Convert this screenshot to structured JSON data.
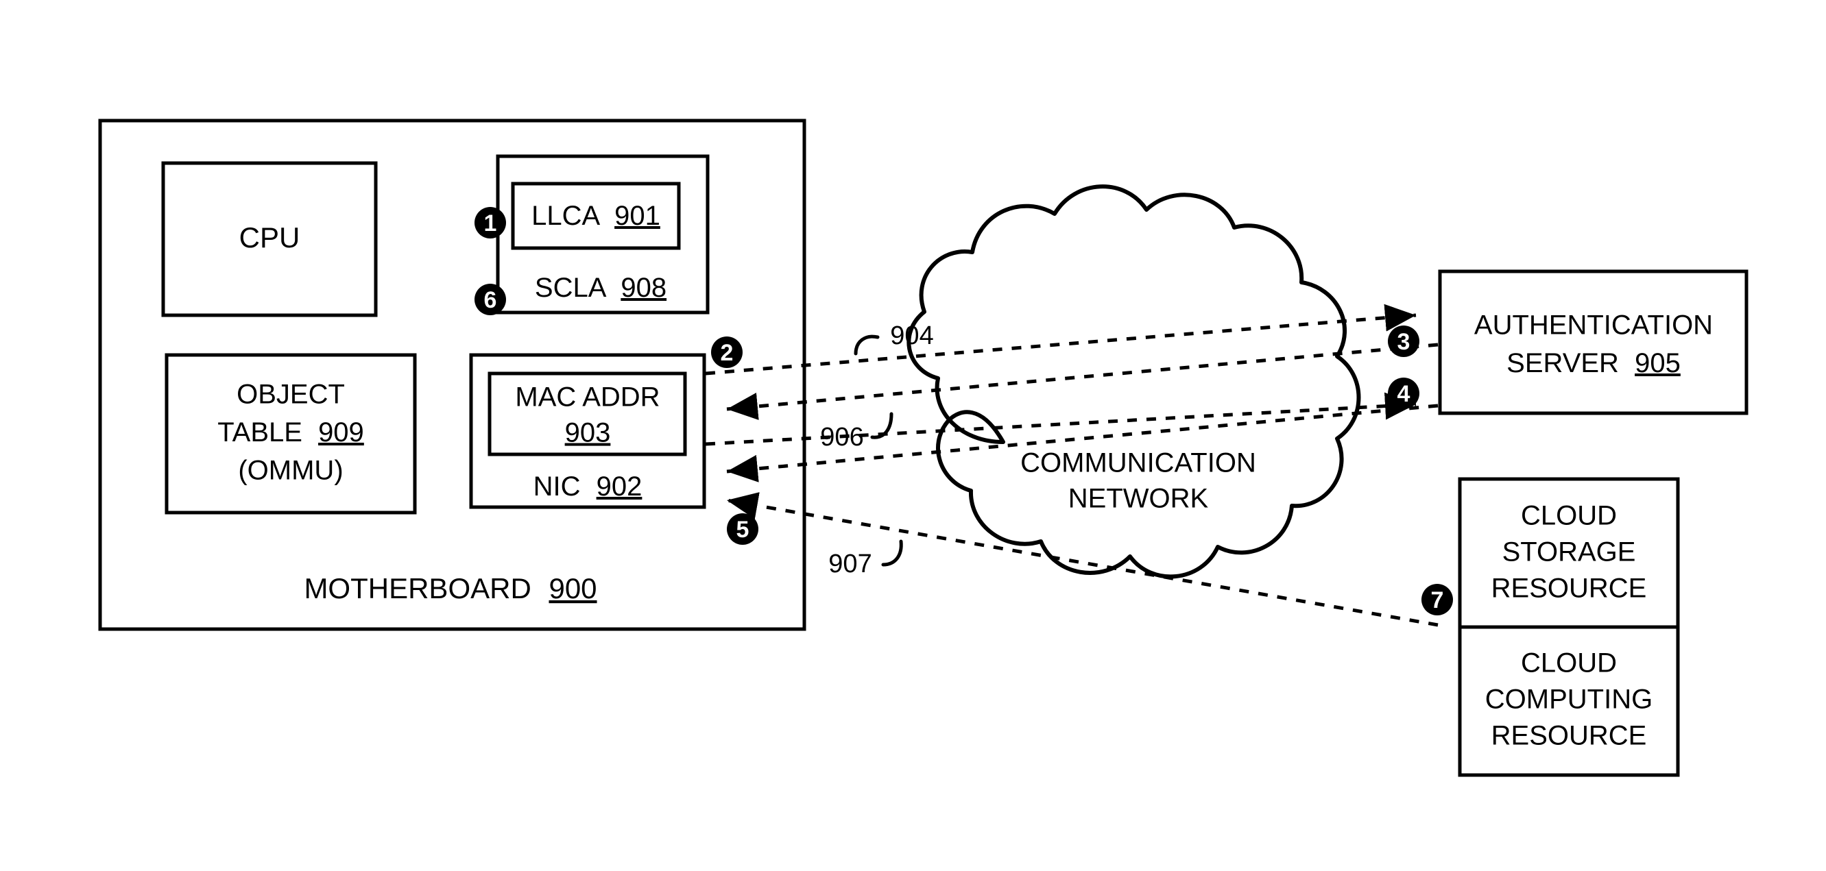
{
  "figure": {
    "title": "Motherboard secure cloud access network diagram",
    "ink_color": "#000000",
    "background_color": "#ffffff"
  },
  "motherboard": {
    "label": "MOTHERBOARD",
    "ref": "900"
  },
  "blocks": {
    "cpu": {
      "label": "CPU"
    },
    "object_table": {
      "line1": "OBJECT",
      "line2": "TABLE",
      "ref": "909",
      "line3": "(OMMU)"
    },
    "scla": {
      "label": "SCLA",
      "ref": "908"
    },
    "llca": {
      "label": "LLCA",
      "ref": "901"
    },
    "nic": {
      "label": "NIC",
      "ref": "902"
    },
    "mac_addr": {
      "line1": "MAC ADDR",
      "ref": "903"
    }
  },
  "network": {
    "line1": "COMMUNICATION",
    "line2": "NETWORK"
  },
  "remote": {
    "auth_server": {
      "line1": "AUTHENTICATION",
      "line2": "SERVER",
      "ref": "905"
    },
    "cloud_storage": {
      "line1": "CLOUD",
      "line2": "STORAGE",
      "line3": "RESOURCE"
    },
    "cloud_computing": {
      "line1": "CLOUD",
      "line2": "COMPUTING",
      "line3": "RESOURCE"
    }
  },
  "link_refs": {
    "ref_904": "904",
    "ref_906": "906",
    "ref_907": "907"
  },
  "step_markers": [
    {
      "id": "step-1",
      "number": "1"
    },
    {
      "id": "step-2",
      "number": "2"
    },
    {
      "id": "step-3",
      "number": "3"
    },
    {
      "id": "step-4",
      "number": "4"
    },
    {
      "id": "step-5",
      "number": "5"
    },
    {
      "id": "step-6",
      "number": "6"
    },
    {
      "id": "step-7",
      "number": "7"
    }
  ]
}
